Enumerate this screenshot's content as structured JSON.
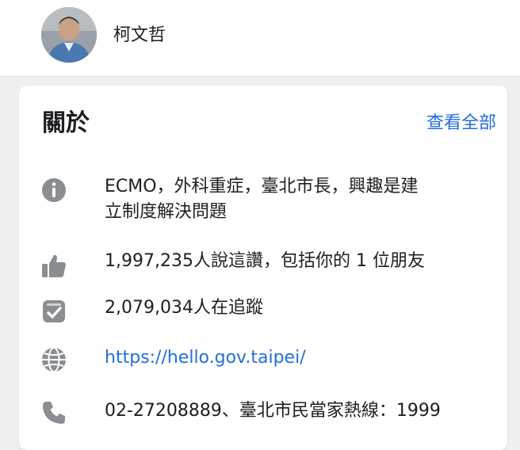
{
  "profile": {
    "name": "柯文哲",
    "avatar_icon": "profile-photo"
  },
  "about": {
    "title": "關於",
    "see_all_label": "查看全部",
    "intro_line1": "ECMO，外科重症，臺北市長，興趣是建",
    "intro_line2": "立制度解決問題",
    "likes": "1,997,235人說這讚，包括你的 1 位朋友",
    "followers": "2,079,034人在追蹤",
    "website": "https://hello.gov.taipei/",
    "phone": "02-27208889、臺北市民當家熱線：1999"
  },
  "icons": {
    "intro": "info-icon",
    "likes": "thumbs-up-icon",
    "followers": "follow-inbox-icon",
    "website": "globe-icon",
    "phone": "phone-icon"
  },
  "colors": {
    "link": "#216fdb",
    "icon": "#8a8d91",
    "background": "#eff0f2"
  }
}
